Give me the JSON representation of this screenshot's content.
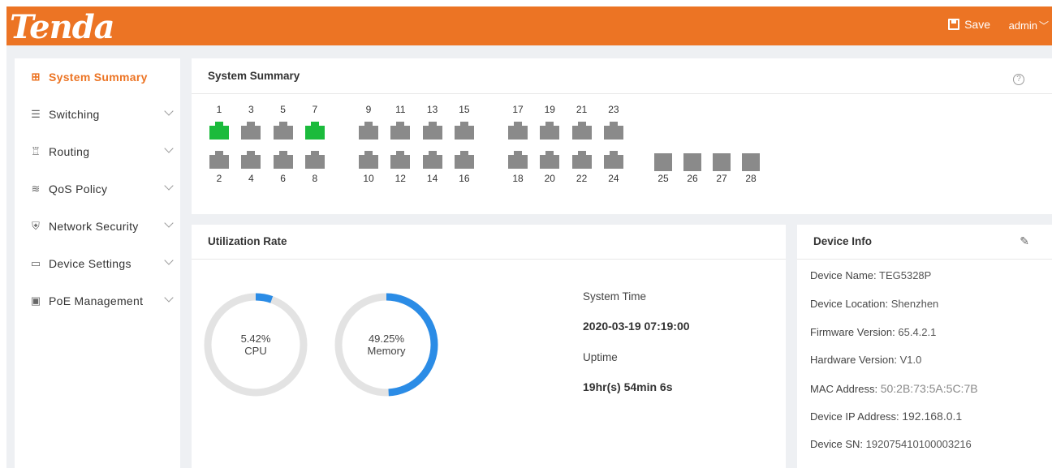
{
  "header": {
    "logo": "Tenda",
    "save_label": "Save",
    "user": "admin"
  },
  "sidebar": {
    "items": [
      {
        "label": "System Summary",
        "icon": "chart-icon",
        "glyph": "⊞",
        "active": true
      },
      {
        "label": "Switching",
        "icon": "switching-icon",
        "glyph": "☰"
      },
      {
        "label": "Routing",
        "icon": "routing-icon",
        "glyph": "♖"
      },
      {
        "label": "QoS Policy",
        "icon": "layers-icon",
        "glyph": "≋"
      },
      {
        "label": "Network Security",
        "icon": "shield-icon",
        "glyph": "⛨"
      },
      {
        "label": "Device Settings",
        "icon": "device-icon",
        "glyph": "▭"
      },
      {
        "label": "PoE Management",
        "icon": "poe-icon",
        "glyph": "▣"
      }
    ]
  },
  "summary": {
    "title": "System Summary",
    "help": "?",
    "ports_odd": [
      "1",
      "3",
      "5",
      "7",
      "9",
      "11",
      "13",
      "15",
      "17",
      "19",
      "21",
      "23"
    ],
    "ports_even": [
      "2",
      "4",
      "6",
      "8",
      "10",
      "12",
      "14",
      "16",
      "18",
      "20",
      "22",
      "24"
    ],
    "sfp_ports": [
      "25",
      "26",
      "27",
      "28"
    ],
    "ports_up": [
      "1",
      "7"
    ],
    "colors": {
      "port_up": "#1bbb3c",
      "port_down": "#8a8a8a"
    }
  },
  "utilization": {
    "title": "Utilization Rate",
    "cpu": {
      "value": 5.42,
      "value_text": "5.42%",
      "label": "CPU"
    },
    "memory": {
      "value": 49.25,
      "value_text": "49.25%",
      "label": "Memory"
    },
    "colors": {
      "track": "#e3e3e3",
      "fill": "#2b8ce6"
    },
    "system_time_label": "System Time",
    "system_time": "2020-03-19 07:19:00",
    "uptime_label": "Uptime",
    "uptime": "19hr(s) 54min 6s"
  },
  "device_info": {
    "title": "Device Info",
    "fields": [
      {
        "key": "Device Name: ",
        "value": "TEG5328P"
      },
      {
        "key": "Device Location: ",
        "value": "Shenzhen"
      },
      {
        "key": "Firmware Version: ",
        "value": "65.4.2.1"
      },
      {
        "key": "Hardware Version: ",
        "value": "V1.0"
      },
      {
        "key": "MAC Address: ",
        "value": "50:2B:73:5A:5C:7B"
      },
      {
        "key": "Device IP Address: ",
        "value": "192.168.0.1"
      },
      {
        "key": "Device SN: ",
        "value": "192075410100003216"
      }
    ]
  }
}
